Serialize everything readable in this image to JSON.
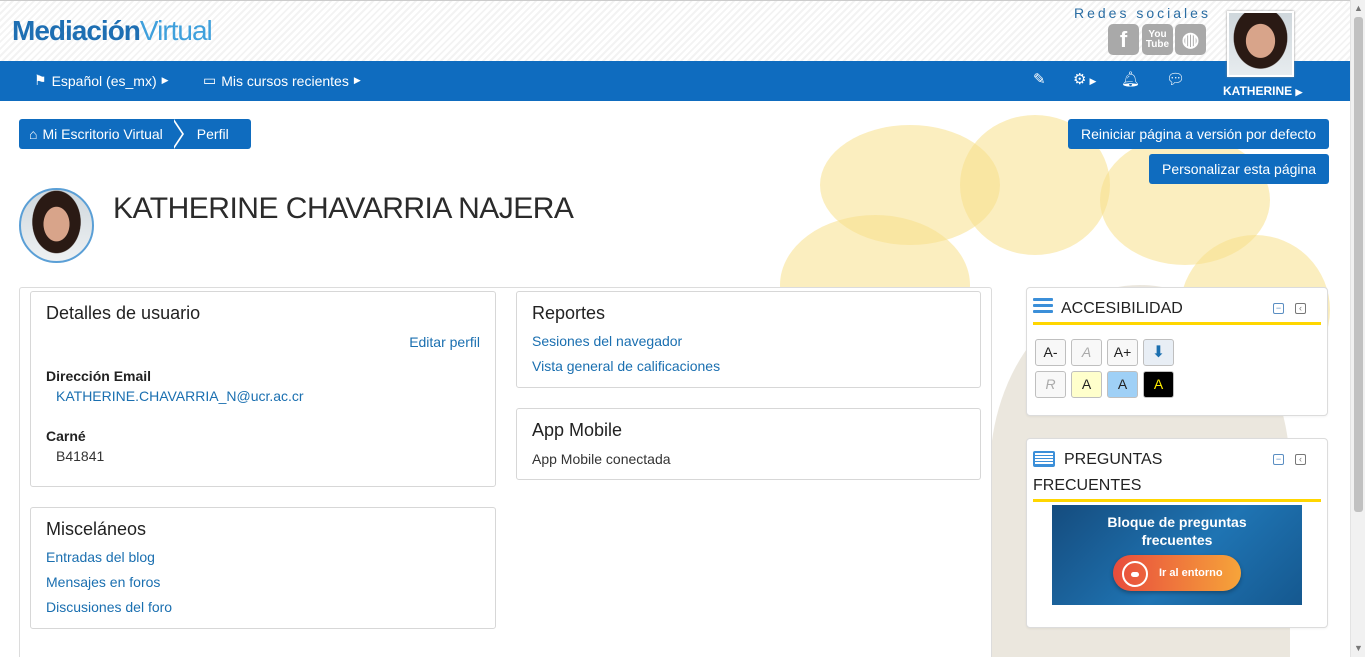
{
  "header": {
    "logo_part1": "Mediación",
    "logo_part2": "Virtual",
    "social_title": "Redes sociales",
    "social_icons": [
      "facebook-icon",
      "youtube-icon",
      "web-icon"
    ],
    "youtube_label": "You Tube"
  },
  "nav": {
    "language": "Español (es_mx)",
    "recent_courses": "Mis cursos recientes",
    "user_name": "KATHERINE",
    "icons": [
      "edit-icon",
      "gear-icon",
      "bell-icon",
      "chat-icon"
    ]
  },
  "breadcrumb": {
    "home": "Mi Escritorio Virtual",
    "current": "Perfil"
  },
  "page_buttons": {
    "reset": "Reiniciar página a versión por defecto",
    "customize": "Personalizar esta página"
  },
  "profile": {
    "name": "KATHERINE CHAVARRIA NAJERA"
  },
  "user_details": {
    "title": "Detalles de usuario",
    "edit_link": "Editar perfil",
    "email_label": "Dirección Email",
    "email_value": "KATHERINE.CHAVARRIA_N@ucr.ac.cr",
    "carne_label": "Carné",
    "carne_value": "B41841"
  },
  "reportes": {
    "title": "Reportes",
    "links": [
      "Sesiones del navegador",
      "Vista general de calificaciones"
    ]
  },
  "app_mobile": {
    "title": "App Mobile",
    "status": "App Mobile conectada"
  },
  "misc": {
    "title": "Misceláneos",
    "links": [
      "Entradas del blog",
      "Mensajes en foros",
      "Discusiones del foro"
    ]
  },
  "accesibilidad": {
    "title": "ACCESIBILIDAD",
    "buttons": [
      "A-",
      "A",
      "A+",
      "R",
      "A",
      "A",
      "A"
    ]
  },
  "faq": {
    "title_line1": "PREGUNTAS",
    "title_line2": "FRECUENTES",
    "banner_line1": "Bloque de preguntas",
    "banner_line2": "frecuentes",
    "banner_button": "Ir al entorno"
  },
  "colors": {
    "primary": "#0f6cbf",
    "accent_yellow": "#ffd600",
    "link": "#1a6fb0"
  }
}
